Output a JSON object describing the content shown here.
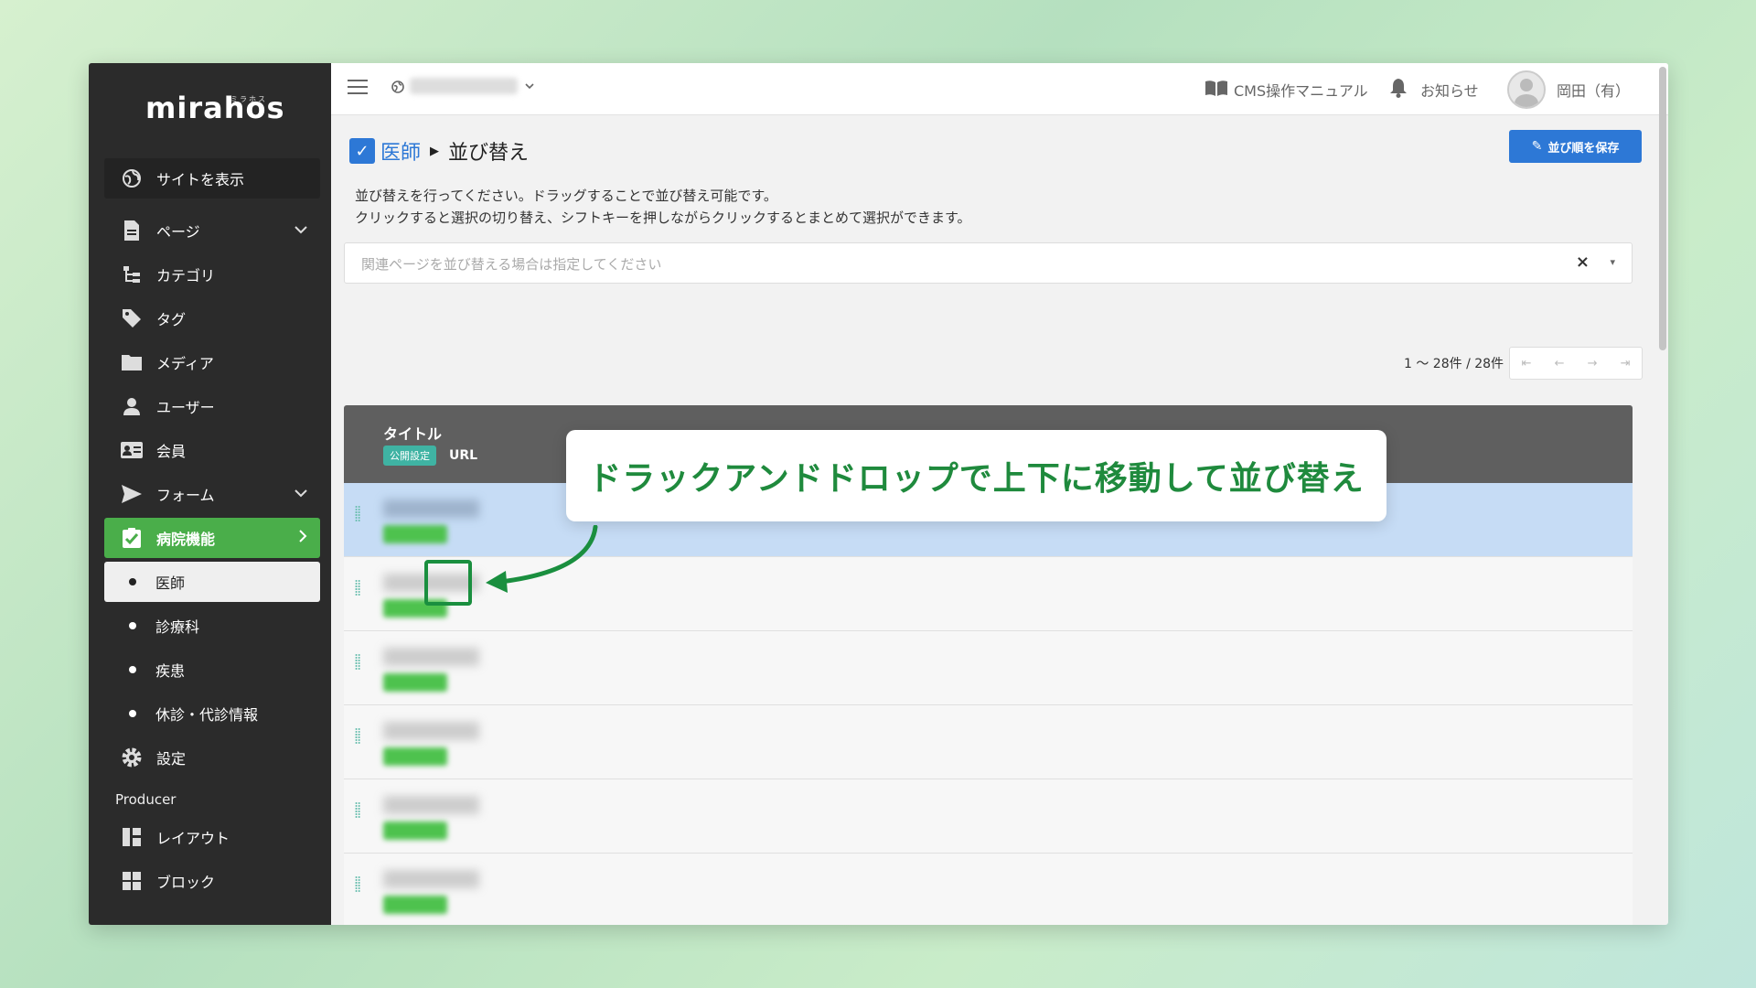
{
  "sidebar": {
    "logo": "mirahos",
    "logo_sub": "ミラホス",
    "view_site": "サイトを表示",
    "items": [
      {
        "label": "ページ",
        "icon": "document-icon",
        "chevron": "⌄"
      },
      {
        "label": "カテゴリ",
        "icon": "category-tree-icon"
      },
      {
        "label": "タグ",
        "icon": "tag-icon"
      },
      {
        "label": "メディア",
        "icon": "folder-icon"
      },
      {
        "label": "ユーザー",
        "icon": "user-icon"
      },
      {
        "label": "会員",
        "icon": "member-card-icon"
      },
      {
        "label": "フォーム",
        "icon": "send-icon",
        "chevron": "⌄"
      }
    ],
    "hospital": {
      "label": "病院機能",
      "icon": "clipboard-check-icon",
      "chevron": "›"
    },
    "hospital_subitems": [
      "医師",
      "診療科",
      "疾患",
      "休診・代診情報"
    ],
    "settings": {
      "label": "設定",
      "icon": "gear-icon"
    },
    "producer_label": "Producer",
    "producer_items": [
      {
        "label": "レイアウト",
        "icon": "layout-icon"
      },
      {
        "label": "ブロック",
        "icon": "grid-icon"
      }
    ]
  },
  "topbar": {
    "manual": "CMS操作マニュアル",
    "notifications": "お知らせ",
    "user_name": "岡田（有）"
  },
  "page": {
    "breadcrumb_parent": "医師",
    "breadcrumb_current": "並び替え",
    "save_button": "並び順を保存",
    "description_line1": "並び替えを行ってください。ドラッグすることで並び替え可能です。",
    "description_line2": "クリックすると選択の切り替え、シフトキーを押しながらクリックするとまとめて選択ができます。",
    "related_placeholder": "関連ページを並び替える場合は指定してください",
    "clear_symbol": "×",
    "dropdown_symbol": "▾"
  },
  "pager": {
    "count": "1 〜 28件 / 28件",
    "first": "⇤",
    "prev": "←",
    "next": "→",
    "last": "⇥"
  },
  "table": {
    "header_title": "タイトル",
    "header_badge": "公開設定",
    "header_url": "URL",
    "rows": 6
  },
  "callout": {
    "text": "ドラックアンドドロップで上下に移動して並び替え"
  },
  "colors": {
    "sidebar_bg": "#2b2b2b",
    "active_green": "#4aae4a",
    "primary_blue": "#2d78d6",
    "selected_row": "#c6dcf5",
    "callout_green": "#1f8a3d"
  }
}
